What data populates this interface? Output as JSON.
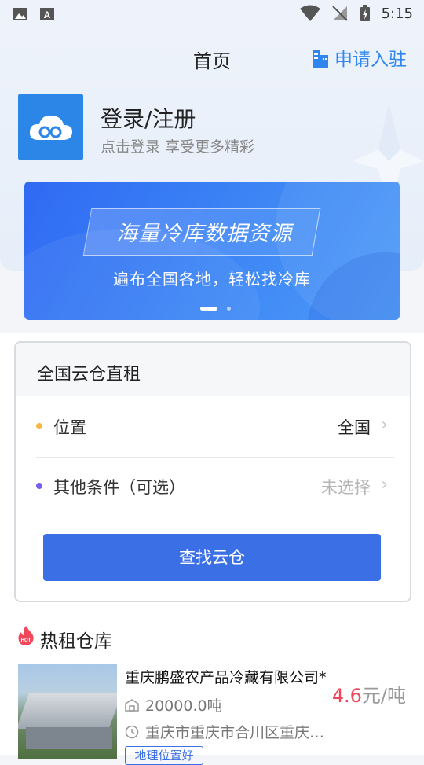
{
  "status_bar": {
    "time": "5:15"
  },
  "header": {
    "title": "首页",
    "apply_label": "申请入驻"
  },
  "profile": {
    "title": "登录/注册",
    "subtitle": "点击登录 享受更多精彩"
  },
  "banner": {
    "title": "海量冷库数据资源",
    "subtitle": "遍布全国各地，轻松找冷库",
    "slide_count": 2,
    "active_slide": 1
  },
  "search_card": {
    "title": "全国云仓直租",
    "rows": [
      {
        "label": "位置",
        "value": "全国",
        "dot_color": "#f5b942",
        "value_color": "#222222"
      },
      {
        "label": "其他条件（可选）",
        "value": "未选择",
        "dot_color": "#7a5cf0",
        "value_color": "#b5b5b5"
      }
    ],
    "button_label": "查找云仓"
  },
  "hot": {
    "title": "热租仓库",
    "badge": "HOT",
    "item": {
      "name": "重庆鹏盛农产品冷藏有限公司*",
      "capacity": "20000.0吨",
      "address": "重庆市重庆市合川区重庆…",
      "price": "4.6",
      "price_unit": "元/吨",
      "tag": "地理位置好"
    }
  },
  "colors": {
    "accent": "#3b6fe6",
    "link": "#2f86ef",
    "price": "#f0465a"
  }
}
